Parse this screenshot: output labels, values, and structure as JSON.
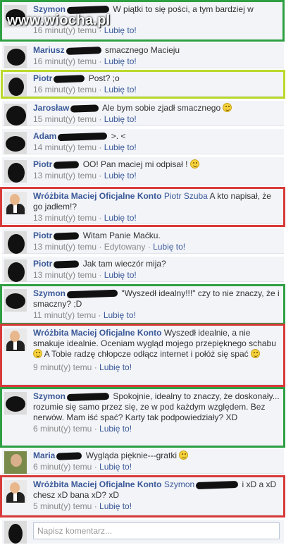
{
  "watermark": "www.wiocha.pl",
  "like_label": "Lubię to!",
  "separator": " · ",
  "compose": {
    "placeholder": "Napisz komentarz..."
  },
  "comments": [
    {
      "author": "Szymon",
      "text": "W piątki to się pości, a tym bardziej w",
      "time": "16 minut(y) temu",
      "highlight": "green"
    },
    {
      "author": "Mariusz",
      "text": "smacznego Macieju",
      "time": "16 minut(y) temu"
    },
    {
      "author": "Piotr",
      "text": "Post? ;o",
      "time": "16 minut(y) temu",
      "highlight": "lime"
    },
    {
      "author": "Jarosław",
      "text": "Ale bym sobie zjadł smacznego",
      "time": "15 minut(y) temu"
    },
    {
      "author": "Adam",
      "text": ">. <",
      "time": "14 minut(y) temu"
    },
    {
      "author": "Piotr",
      "text": "OO! Pan maciej mi odpisał !",
      "time": "13 minut(y) temu"
    },
    {
      "author": "Wróżbita Maciej Oficjalne Konto",
      "tag": "Piotr Szuba",
      "text": "A kto napisał, że go jadłem!?",
      "time": "13 minut(y) temu",
      "highlight": "red"
    },
    {
      "author": "Piotr",
      "text": "Witam Panie Maćku.",
      "time": "13 minut(y) temu",
      "edited": "Edytowany"
    },
    {
      "author": "Piotr",
      "text": "Jak tam wieczór mija?",
      "time": "13 minut(y) temu"
    },
    {
      "author": "Szymon",
      "text": "\"Wyszedł idealny!!!\" czy to nie znaczy, że i smaczny? ;D",
      "time": "11 minut(y) temu",
      "highlight": "green"
    },
    {
      "author": "Wróżbita Maciej Oficjalne Konto",
      "text": "Wyszedł idealnie, a nie smakuje idealnie. Oceniam wygląd mojego przepięknego schabu",
      "text2": "A Tobie radzę chłopcze odłącz internet i połóż się spać",
      "time": "9 minut(y) temu",
      "highlight": "red"
    },
    {
      "author": "Szymon",
      "text": "Spokojnie, idealny to znaczy, że doskonały... rozumie się samo przez się, ze w pod każdym względem. Bez nerwów. Mam iść spać? Karty tak podpowiedziały? XD",
      "time": "6 minut(y) temu",
      "highlight": "green"
    },
    {
      "author": "Maria",
      "text": "Wygląda pięknie---gratki",
      "time": "6 minut(y) temu"
    },
    {
      "author": "Wróżbita Maciej Oficjalne Konto",
      "tag": "Szymon",
      "text": "i xD a xD chesz xD bana xD? xD",
      "time": "5 minut(y) temu",
      "highlight": "red"
    }
  ],
  "colors": {
    "link": "#3b5998",
    "green": "#2ea043",
    "red": "#d83a3a",
    "lime": "#bad92c",
    "row_bg": "#f2f4f8"
  }
}
